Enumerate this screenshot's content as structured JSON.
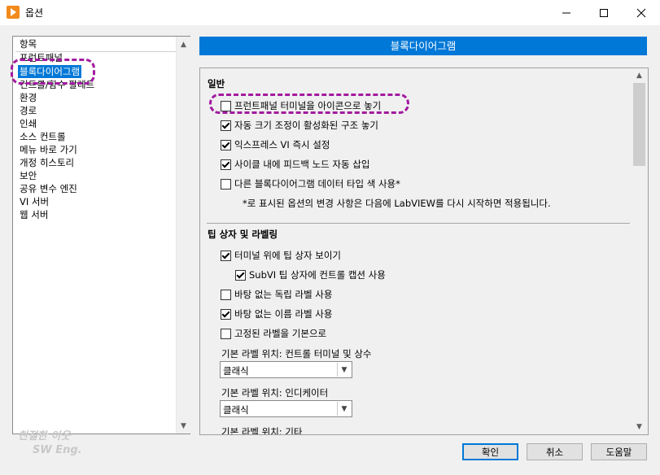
{
  "window": {
    "title": "옵션"
  },
  "left_list": {
    "header": "항목",
    "items": [
      "프런트패널",
      "블록다이어그램",
      "컨트롤/함수 팔레트",
      "환경",
      "경로",
      "인쇄",
      "소스 컨트롤",
      "메뉴 바로 가기",
      "개정 히스토리",
      "보안",
      "공유 변수 엔진",
      "VI 서버",
      "웹 서버"
    ],
    "selected": "블록다이어그램"
  },
  "panel": {
    "banner": "블록다이어그램",
    "general": {
      "title": "일반",
      "options": [
        {
          "label": "프런트패널 터미널을 아이콘으로 놓기",
          "checked": false
        },
        {
          "label": "자동 크기 조정이 활성화된 구조 놓기",
          "checked": true
        },
        {
          "label": "익스프레스 VI 즉시 설정",
          "checked": true
        },
        {
          "label": "사이클 내에 피드백 노드 자동 삽입",
          "checked": true
        },
        {
          "label": "다른 블록다이어그램 데이터 타입 색 사용*",
          "checked": false
        }
      ],
      "note": "*로 표시된 옵션의 변경 사항은 다음에 LabVIEW를 다시 시작하면 적용됩니다."
    },
    "tips": {
      "title": "팁 상자 및 라벨링",
      "options": [
        {
          "label": "터미널 위에 팁 상자 보이기",
          "checked": true
        },
        {
          "label": "SubVI 팁 상자에 컨트롤 캡션 사용",
          "checked": true
        },
        {
          "label": "바탕 없는 독립 라벨 사용",
          "checked": false
        },
        {
          "label": "바탕 없는 이름 라벨 사용",
          "checked": true
        },
        {
          "label": "고정된 라벨을 기본으로",
          "checked": false
        }
      ],
      "label_pos_1": "기본 라벨 위치: 컨트롤 터미널 및 상수",
      "select_1": "클래식",
      "label_pos_2": "기본 라벨 위치: 인디케이터",
      "select_2": "클래식",
      "label_pos_3": "기본 라벨 위치: 기타"
    }
  },
  "buttons": {
    "ok": "확인",
    "cancel": "취소",
    "help": "도움말"
  },
  "watermark": {
    "line1": "친절한 이웃",
    "line2": "SW Eng."
  },
  "colors": {
    "accent": "#0078d7",
    "highlight": "#a21aa0",
    "app_icon": "#f28a1c"
  }
}
